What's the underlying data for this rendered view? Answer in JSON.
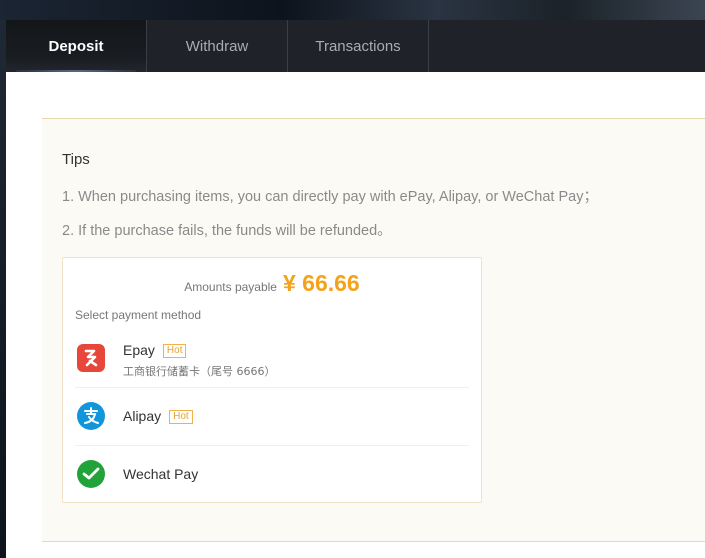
{
  "tabs": [
    {
      "label": "Deposit",
      "active": true
    },
    {
      "label": "Withdraw",
      "active": false
    },
    {
      "label": "Transactions",
      "active": false
    }
  ],
  "tips": {
    "title": "Tips",
    "items": [
      "1. When purchasing items, you can directly pay with ePay, Alipay, or WeChat Pay；",
      "2. If the purchase fails, the funds will be refunded。"
    ]
  },
  "payment": {
    "amount_label": "Amounts payable",
    "amount_value": "¥ 66.66",
    "select_label": "Select payment method",
    "methods": [
      {
        "name": "Epay",
        "badge": "Hot",
        "detail": "工商银行储蓄卡（尾号 6666）",
        "icon": "epay-icon"
      },
      {
        "name": "Alipay",
        "badge": "Hot",
        "icon": "alipay-icon"
      },
      {
        "name": "Wechat Pay",
        "icon": "wechat-pay-icon"
      }
    ]
  },
  "colors": {
    "accent": "#f5a21b",
    "tab_bar": "#1f2329",
    "panel_bg": "#fcfaf5",
    "epay": "#e6473a",
    "alipay": "#1296db",
    "wechat": "#22a33a"
  }
}
